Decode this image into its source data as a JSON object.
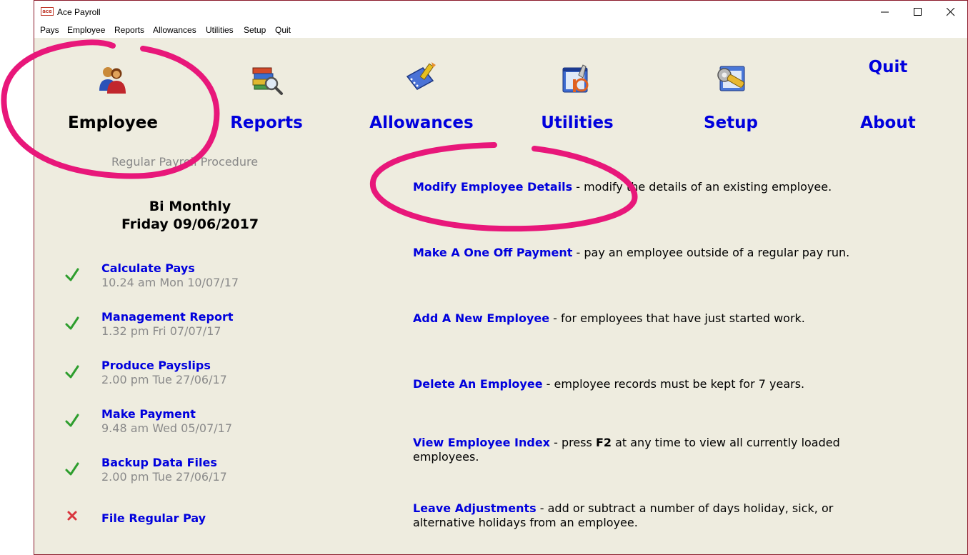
{
  "window": {
    "title": "Ace Payroll",
    "icon": "ace-app-icon"
  },
  "menu": [
    "Pays",
    "Employee",
    "Reports",
    "Allowances",
    "Utilities",
    "Setup",
    "Quit"
  ],
  "nav": {
    "employee": "Employee",
    "reports": "Reports",
    "allowances": "Allowances",
    "utilities": "Utilities",
    "setup": "Setup",
    "quit": "Quit",
    "about": "About"
  },
  "procedure": {
    "title": "Regular Payroll Procedure",
    "period_type": "Bi Monthly",
    "period_date": "Friday 09/06/2017",
    "steps": [
      {
        "title": "Calculate Pays",
        "time": "10.24 am Mon 10/07/17",
        "status": "done"
      },
      {
        "title": "Management Report",
        "time": "1.32 pm Fri 07/07/17",
        "status": "done"
      },
      {
        "title": "Produce Payslips",
        "time": "2.00 pm Tue 27/06/17",
        "status": "done"
      },
      {
        "title": "Make Payment",
        "time": "9.48 am Wed 05/07/17",
        "status": "done"
      },
      {
        "title": "Backup Data Files",
        "time": "2.00 pm Tue 27/06/17",
        "status": "done"
      },
      {
        "title": "File Regular Pay",
        "time": "",
        "status": "not-done"
      }
    ]
  },
  "tasks": [
    {
      "link": "Modify Employee Details",
      "desc": " - modify the details of an existing employee."
    },
    {
      "link": "Make A One Off Payment",
      "desc": " - pay an employee outside of a regular pay run."
    },
    {
      "link": "Add A New Employee",
      "desc": " - for employees that have just started work."
    },
    {
      "link": "Delete An Employee",
      "desc": " - employee records must be kept for 7 years."
    },
    {
      "link": "View Employee Index",
      "desc_pre": " - press ",
      "key": "F2",
      "desc_post": " at any time to view all currently loaded employees."
    },
    {
      "link": "Leave Adjustments",
      "desc": " - add or subtract a number of days holiday, sick, or alternative holidays from an employee."
    }
  ],
  "colors": {
    "background": "#eeecdf",
    "link": "#0000dd",
    "check": "#2e9e2e",
    "cross": "#d9363e",
    "annotation": "#e8177a",
    "border": "#8b1a2b"
  }
}
